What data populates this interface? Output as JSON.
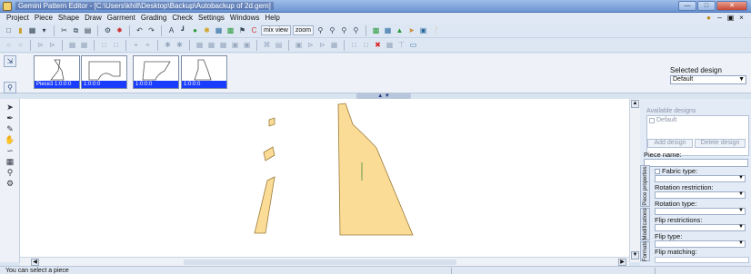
{
  "window": {
    "title": "Gemini Pattern Editor - [C:\\Users\\khill\\Desktop\\Backup\\Autobackup of 2d.gem]"
  },
  "menu": [
    "Project",
    "Piece",
    "Shape",
    "Draw",
    "Garment",
    "Grading",
    "Check",
    "Settings",
    "Windows",
    "Help"
  ],
  "toolbar": {
    "mix_view": "mix view",
    "zoom": "zoom"
  },
  "pieces": [
    {
      "name": "Piece3",
      "value": "1:0:0:0"
    },
    {
      "name": "",
      "value": "1:0:0:0"
    },
    {
      "name": "",
      "value": "1:0:0:0"
    },
    {
      "name": "",
      "value": "1:0:0:0"
    }
  ],
  "selected_design": {
    "label": "Selected design",
    "value": "Default"
  },
  "designs": {
    "label": "Available designs",
    "items": [
      "Default"
    ],
    "add_label": "Add design",
    "delete_label": "Delete design"
  },
  "properties": {
    "piece_name_label": "Piece name:",
    "fabric_type": "Fabric type:",
    "rotation_restriction": "Rotation restriction:",
    "rotation_type": "Rotation type:",
    "flip_restrictions": "Flip restrictions:",
    "flip_type": "Flip type:",
    "flip_matching": "Flip matching:"
  },
  "side_tabs": {
    "piece_properties": "Piece properties",
    "modifications": "Modifications",
    "formats": "Formats"
  },
  "status": {
    "text": "You can select a piece"
  },
  "colors": {
    "piece_fill": "#fbdc96",
    "piece_stroke": "#9a7a3a",
    "selection_blue": "#1a3cff"
  },
  "icons": [
    "arrow-icon",
    "pen-icon",
    "pencil-icon",
    "hand-icon",
    "zoom-icon",
    "gear-icon"
  ]
}
